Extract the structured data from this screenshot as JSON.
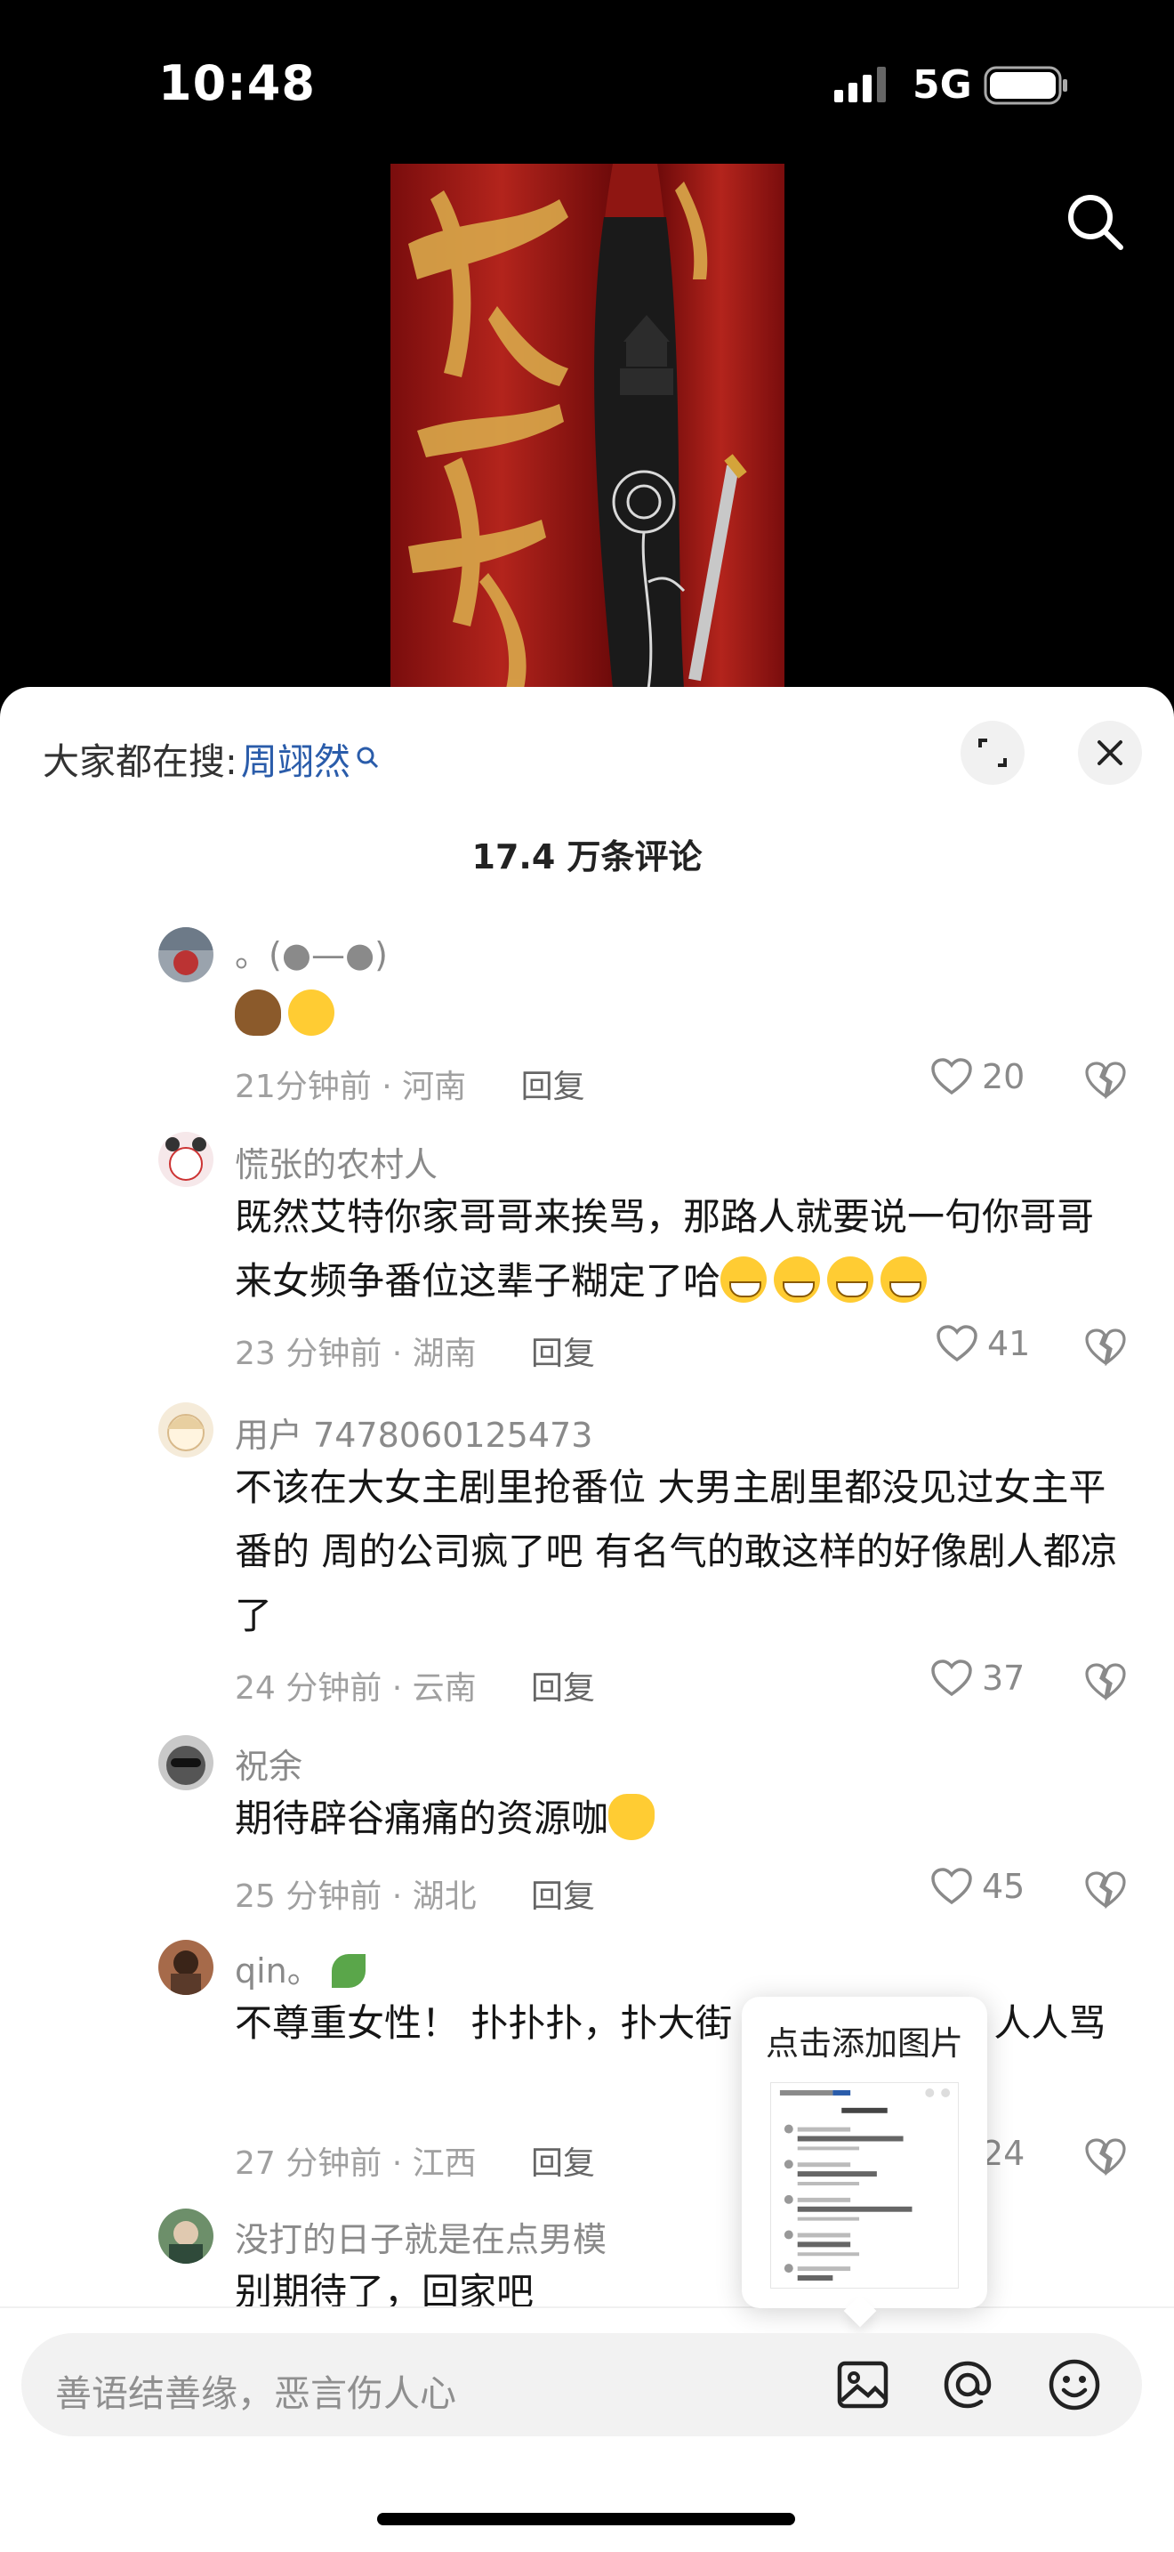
{
  "status_bar": {
    "time": "10:48",
    "network": "5G"
  },
  "sheet": {
    "trending_label": "大家都在搜:",
    "trending_keyword": "周翊然",
    "comment_count": "17.4 万条评论"
  },
  "comments": [
    {
      "user": "。(●—●)",
      "text": "",
      "time": "21分钟前 · 河南",
      "reply": "回复",
      "likes": "20"
    },
    {
      "user": "慌张的农村人",
      "text": "既然艾特你家哥哥来挨骂，那路人就要说一句你哥哥来女频争番位这辈子糊定了哈",
      "time": "23 分钟前 · 湖南",
      "reply": "回复",
      "likes": "41"
    },
    {
      "user": "用户 7478060125473",
      "text": "不该在大女主剧里抢番位 大男主剧里都没见过女主平番的 周的公司疯了吧 有名气的敢这样的好像剧人都凉了",
      "time": "24 分钟前 · 云南",
      "reply": "回复",
      "likes": "37"
    },
    {
      "user": "祝余",
      "text": "期待辟谷痛痛的资源咖",
      "time": "25 分钟前 · 湖北",
      "reply": "回复",
      "likes": "45"
    },
    {
      "user": "qin。",
      "text": "不尊重女性！ 扑扑扑，扑大街",
      "text_tail": "人，人人骂",
      "time": "27 分钟前 · 江西",
      "reply": "回复",
      "likes": "24"
    },
    {
      "user": "没打的日子就是在点男模",
      "text": "别期待了，回家吧"
    }
  ],
  "popup": {
    "title": "点击添加图片"
  },
  "input": {
    "placeholder": "善语结善缘，恶言伤人心"
  },
  "icons": [
    "search-icon",
    "expand-icon",
    "close-icon",
    "heart-icon",
    "broken-heart-icon",
    "image-icon",
    "at-icon",
    "emoji-icon"
  ]
}
